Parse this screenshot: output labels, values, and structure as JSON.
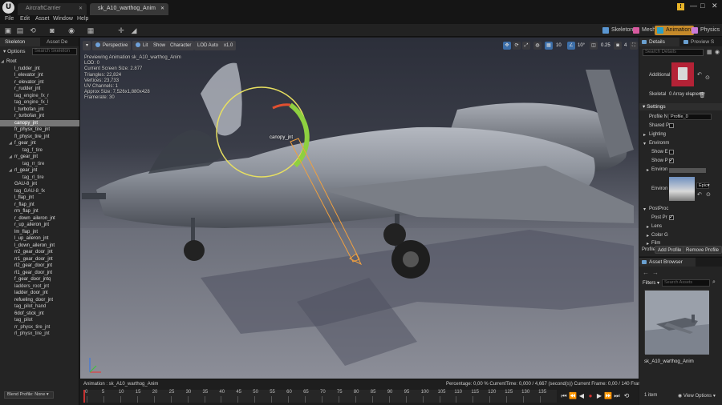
{
  "titlebar": {
    "logo": "U",
    "tabs": [
      {
        "label": "AircraftCarrier"
      },
      {
        "label": "sk_A10_warthog_Anim"
      }
    ],
    "controls": {
      "alert": "!",
      "minimize": "—",
      "maximize": "□",
      "close": "✕"
    }
  },
  "menu": {
    "items": [
      "File",
      "Edit",
      "Asset",
      "Window",
      "Help"
    ]
  },
  "toolbar": {
    "icons": [
      "save-icon",
      "browse-icon",
      "reimport-icon",
      "camera-icon",
      "record-icon",
      "add-icon",
      "preview-mesh-icon",
      "apply-icon"
    ],
    "modes": [
      {
        "label": "Skeleton",
        "color": "#5a96d2"
      },
      {
        "label": "Mesh",
        "color": "#d85aa0"
      },
      {
        "label": "Animation",
        "color": "#2aa0c8"
      },
      {
        "label": "Physics",
        "color": "#c87ad8"
      }
    ],
    "active_mode": "Animation"
  },
  "left_panel": {
    "tabs": [
      {
        "label": "Skeleton"
      },
      {
        "label": "Asset De"
      }
    ],
    "options_label": "Options",
    "search_placeholder": "Search Skeleton",
    "tree": [
      {
        "label": "Root",
        "indent": 0,
        "expanded": true
      },
      {
        "label": "l_rudder_jnt",
        "indent": 1
      },
      {
        "label": "l_elevator_jnt",
        "indent": 1
      },
      {
        "label": "r_elevator_jnt",
        "indent": 1
      },
      {
        "label": "r_rudder_jnt",
        "indent": 1
      },
      {
        "label": "tag_engine_fx_r",
        "indent": 1,
        "socket": true
      },
      {
        "label": "tag_engine_fx_l",
        "indent": 1,
        "socket": true
      },
      {
        "label": "l_turbofan_jnt",
        "indent": 1
      },
      {
        "label": "r_turbofan_jnt",
        "indent": 1
      },
      {
        "label": "canopy_jnt",
        "indent": 1,
        "selected": true
      },
      {
        "label": "fr_physx_tire_jnt",
        "indent": 1
      },
      {
        "label": "fl_physx_tire_jnt",
        "indent": 1
      },
      {
        "label": "f_gear_jnt",
        "indent": 1,
        "expanded": true
      },
      {
        "label": "tag_f_tire",
        "indent": 2,
        "socket": true
      },
      {
        "label": "rr_gear_jnt",
        "indent": 1,
        "expanded": true
      },
      {
        "label": "tag_rr_tire",
        "indent": 2,
        "socket": true
      },
      {
        "label": "rl_gear_jnt",
        "indent": 1,
        "expanded": true
      },
      {
        "label": "tag_rl_tire",
        "indent": 2,
        "socket": true
      },
      {
        "label": "GAU-8_jnt",
        "indent": 1
      },
      {
        "label": "tag_GAU-8_fx",
        "indent": 1,
        "socket": true
      },
      {
        "label": "l_flap_jnt",
        "indent": 1
      },
      {
        "label": "r_flap_jnt",
        "indent": 1
      },
      {
        "label": "rm_flap_jnt",
        "indent": 1
      },
      {
        "label": "r_down_aileron_jnt",
        "indent": 1
      },
      {
        "label": "r_up_aileron_jnt",
        "indent": 1
      },
      {
        "label": "lm_flap_jnt",
        "indent": 1
      },
      {
        "label": "l_up_aileron_jnt",
        "indent": 1
      },
      {
        "label": "l_down_aileron_jnt",
        "indent": 1
      },
      {
        "label": "rr2_gear_door_jnt",
        "indent": 1
      },
      {
        "label": "rr1_gear_door_jnt",
        "indent": 1
      },
      {
        "label": "rl2_gear_door_jnt",
        "indent": 1
      },
      {
        "label": "rl1_gear_door_jnt",
        "indent": 1
      },
      {
        "label": "f_gear_door_jntq",
        "indent": 1
      },
      {
        "label": "ladders_root_jnt",
        "indent": 1,
        "socket": true
      },
      {
        "label": "ladder_door_jnt",
        "indent": 1
      },
      {
        "label": "refueling_door_jnt",
        "indent": 1
      },
      {
        "label": "tag_pilot_hand",
        "indent": 1,
        "socket": true
      },
      {
        "label": "6dof_stick_jnt",
        "indent": 1
      },
      {
        "label": "tag_pilot",
        "indent": 1,
        "socket": true
      },
      {
        "label": "rr_physx_tire_jnt",
        "indent": 1,
        "socket": true
      },
      {
        "label": "rl_physx_tire_jnt",
        "indent": 1,
        "socket": true
      }
    ],
    "blend_profile": "Blend Profile: None"
  },
  "viewport": {
    "buttons": [
      "Perspective",
      "Lit",
      "Show",
      "Character",
      "LOD Auto",
      "x1.0"
    ],
    "stats": [
      "Previewing Animation sk_A10_warthog_Anim",
      "LOD: 0",
      "Current Screen Size: 2.877",
      "Triangles: 22,824",
      "Vertices: 23,733",
      "UV Channels: 1",
      "Approx Size: 7,526x1,880x428",
      "Framerate: 30"
    ],
    "socket_label": "canopy_jnt",
    "right_tools": {
      "grid_snap": "10",
      "rot_snap": "10°",
      "scale_snap": "0.25",
      "cam_speed": "4"
    }
  },
  "timeline": {
    "animation_label": "Animation : sk_A10_warthog_Anim",
    "status": "Percentage: 0,00 %  CurrentTime: 0,000 / 4,667 (second(s))  Current Frame: 0,00 / 140 Frame",
    "ticks": [
      "0",
      "5",
      "10",
      "15",
      "20",
      "25",
      "30",
      "35",
      "40",
      "45",
      "50",
      "55",
      "60",
      "65",
      "70",
      "75",
      "80",
      "85",
      "90",
      "95",
      "100",
      "105",
      "110",
      "115",
      "120",
      "125",
      "130",
      "135"
    ],
    "transport": [
      "to-start-icon",
      "step-back-icon",
      "play-reverse-icon",
      "record-icon",
      "play-icon",
      "step-forward-icon",
      "to-end-icon",
      "loop-icon"
    ]
  },
  "details": {
    "tabs": [
      {
        "label": "Details"
      },
      {
        "label": "Preview S"
      }
    ],
    "search_placeholder": "Search Details",
    "additional_label": "Additional",
    "skeletal_label": "Skeletal",
    "skeletal_value": "0 Array element",
    "settings_header": "Settings",
    "profile_name_label": "Profile N",
    "profile_name_value": "Profile_0",
    "shared_label": "Shared Pr",
    "lighting_label": "Lighting",
    "environment_label": "Environm",
    "show_e_label": "Show E",
    "show_p_label": "Show P",
    "environ_label": "Environ",
    "env_map_label": "Environ",
    "env_combo": "Epic",
    "postproc_label": "PostProc",
    "post_pr_label": "Post Pr",
    "lens_label": "Lens",
    "color_label": "Color G",
    "film_label": "Film",
    "profile_label": "Profile",
    "add_profile": "Add Profile",
    "remove_profile": "Remove Profile"
  },
  "asset_browser": {
    "tab_label": "Asset Browser",
    "filters_label": "Filters",
    "search_placeholder": "Search Assets",
    "asset_name": "sk_A10_warthog_Anim",
    "item_count": "1 item",
    "view_options": "View Options"
  }
}
